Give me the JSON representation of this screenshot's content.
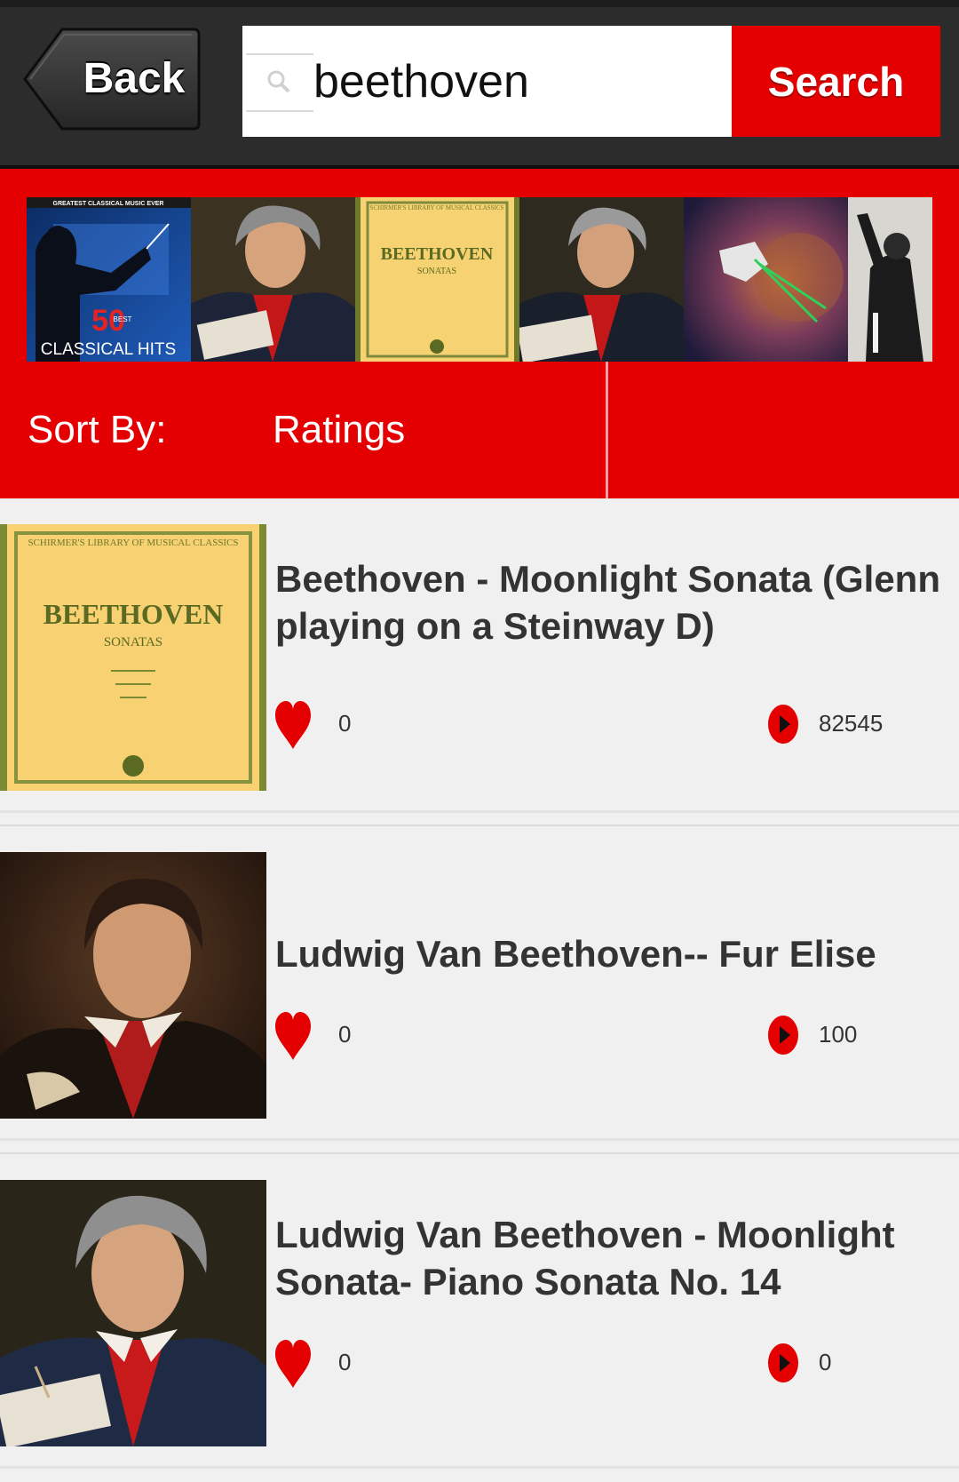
{
  "header": {
    "back_label": "Back",
    "search_value": "beethoven",
    "search_label": "Search"
  },
  "carousel": {
    "items": [
      {
        "name": "50 Best Classical Hits album",
        "top_text": "GREATEST CLASSICAL MUSIC EVER",
        "number": "50",
        "badge": "BEST",
        "bottom_text": "CLASSICAL HITS"
      },
      {
        "name": "Beethoven portrait"
      },
      {
        "name": "Schirmer's Library Beethoven Sonatas cover",
        "header": "SCHIRMER'S LIBRARY\nOF MUSICAL CLASSICS",
        "title": "BEETHOVEN",
        "subtitle": "SONATAS"
      },
      {
        "name": "Beethoven portrait"
      },
      {
        "name": "Space cat artwork"
      },
      {
        "name": "Conductor photo"
      }
    ]
  },
  "sort": {
    "label": "Sort By:",
    "value": "Ratings"
  },
  "results": [
    {
      "title": "Beethoven - Moonlight Sonata (Glenn playing on a Steinway D)",
      "likes": "0",
      "plays": "82545",
      "art": "book",
      "art_header": "SCHIRMER'S LIBRARY\nOF MUSICAL CLASSICS",
      "art_title": "BEETHOVEN",
      "art_subtitle": "SONATAS"
    },
    {
      "title": "Ludwig Van Beethoven-- Fur Elise",
      "likes": "0",
      "plays": "100",
      "art": "portrait-dark"
    },
    {
      "title": "Ludwig Van Beethoven - Moonlight Sonata-  Piano Sonata No. 14",
      "likes": "0",
      "plays": "0",
      "art": "portrait-blue"
    }
  ],
  "colors": {
    "accent": "#e40000",
    "header_bg": "#2c2c2c",
    "list_bg": "#f0f0f0",
    "text": "#333333"
  }
}
